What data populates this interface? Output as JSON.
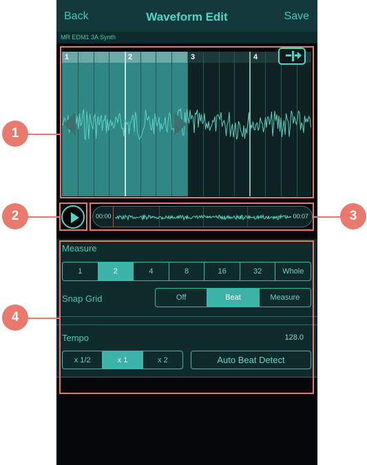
{
  "navbar": {
    "back_label": "Back",
    "title": "Waveform Edit",
    "save_label": "Save"
  },
  "sample_name": "MR EDM1 3A Synth",
  "ruler": {
    "measures": [
      "1",
      "2",
      "3",
      "4"
    ]
  },
  "overview": {
    "start_time": "00:00",
    "end_time": "00:07"
  },
  "measure": {
    "label": "Measure",
    "options": [
      "1",
      "2",
      "4",
      "8",
      "16",
      "32",
      "Whole"
    ],
    "selected": "2"
  },
  "snap_grid": {
    "label": "Snap Grid",
    "options": [
      "Off",
      "Beat",
      "Measure"
    ],
    "selected": "Beat"
  },
  "tempo": {
    "label": "Tempo",
    "value": "128.0",
    "multipliers": [
      "x 1/2",
      "x 1",
      "x 2"
    ],
    "selected": "x 1",
    "auto_beat_label": "Auto Beat Detect"
  },
  "callouts": [
    "1",
    "2",
    "3",
    "4"
  ],
  "colors": {
    "accent": "#4fd6c8",
    "selection": "#2f8884",
    "callout": "#e8796c",
    "playhead": "#d94848"
  }
}
